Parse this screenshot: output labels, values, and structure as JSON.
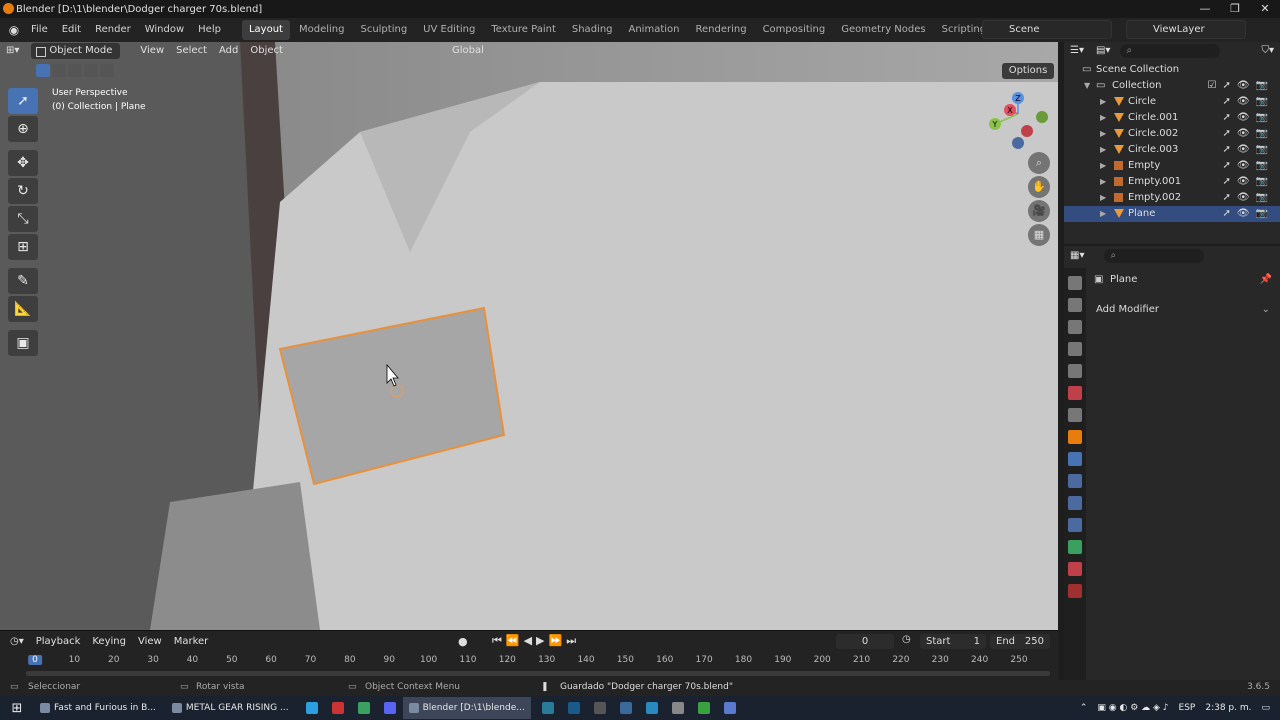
{
  "window": {
    "title": "Blender [D:\\1\\blender\\Dodger charger 70s.blend]",
    "controls": [
      "—",
      "❐",
      "✕"
    ]
  },
  "menu": {
    "items": [
      "File",
      "Edit",
      "Render",
      "Window",
      "Help"
    ],
    "workspaces": [
      "Layout",
      "Modeling",
      "Sculpting",
      "UV Editing",
      "Texture Paint",
      "Shading",
      "Animation",
      "Rendering",
      "Compositing",
      "Geometry Nodes",
      "Scripting"
    ],
    "active_workspace": "Layout",
    "add_workspace": "+",
    "scene": "Scene",
    "view_layer": "ViewLayer"
  },
  "viewport": {
    "mode": "Object Mode",
    "menus": [
      "View",
      "Select",
      "Add",
      "Object"
    ],
    "orientation": "Global",
    "options_label": "Options",
    "perspective_label": "User Perspective",
    "collection_label": "(0) Collection | Plane",
    "gizmo": {
      "x": "X",
      "y": "Y",
      "z": "Z"
    }
  },
  "timeline": {
    "menus": [
      "Playback",
      "Keying",
      "View",
      "Marker"
    ],
    "current_frame": "0",
    "start_label": "Start",
    "start": "1",
    "end_label": "End",
    "end": "250",
    "ticks": [
      "0",
      "10",
      "20",
      "30",
      "40",
      "50",
      "60",
      "70",
      "80",
      "90",
      "100",
      "110",
      "120",
      "130",
      "140",
      "150",
      "160",
      "170",
      "180",
      "190",
      "200",
      "210",
      "220",
      "230",
      "240",
      "250"
    ]
  },
  "outliner": {
    "root": "Scene Collection",
    "collection": "Collection",
    "items": [
      {
        "name": "Circle",
        "type": "mesh"
      },
      {
        "name": "Circle.001",
        "type": "mesh"
      },
      {
        "name": "Circle.002",
        "type": "mesh"
      },
      {
        "name": "Circle.003",
        "type": "mesh"
      },
      {
        "name": "Empty",
        "type": "empty"
      },
      {
        "name": "Empty.001",
        "type": "empty"
      },
      {
        "name": "Empty.002",
        "type": "empty"
      },
      {
        "name": "Plane",
        "type": "mesh",
        "selected": true
      }
    ]
  },
  "properties": {
    "object_name": "Plane",
    "add_modifier": "Add Modifier"
  },
  "statusbar": {
    "left": "Seleccionar",
    "middle": "Rotar vista",
    "context": "Object Context Menu",
    "message": "Guardado \"Dodger charger 70s.blend\"",
    "version": "3.6.5"
  },
  "taskbar": {
    "apps": [
      {
        "label": "Fast and Furious in B..."
      },
      {
        "label": "METAL GEAR RISING ..."
      },
      {
        "label": "Blender [D:\\1\\blende...",
        "active": true
      }
    ],
    "language": "ESP",
    "time": "2:38 p. m."
  },
  "colors": {
    "accent": "#4772b3",
    "selection_outline": "#e8913a",
    "selected_row": "#334d80"
  }
}
